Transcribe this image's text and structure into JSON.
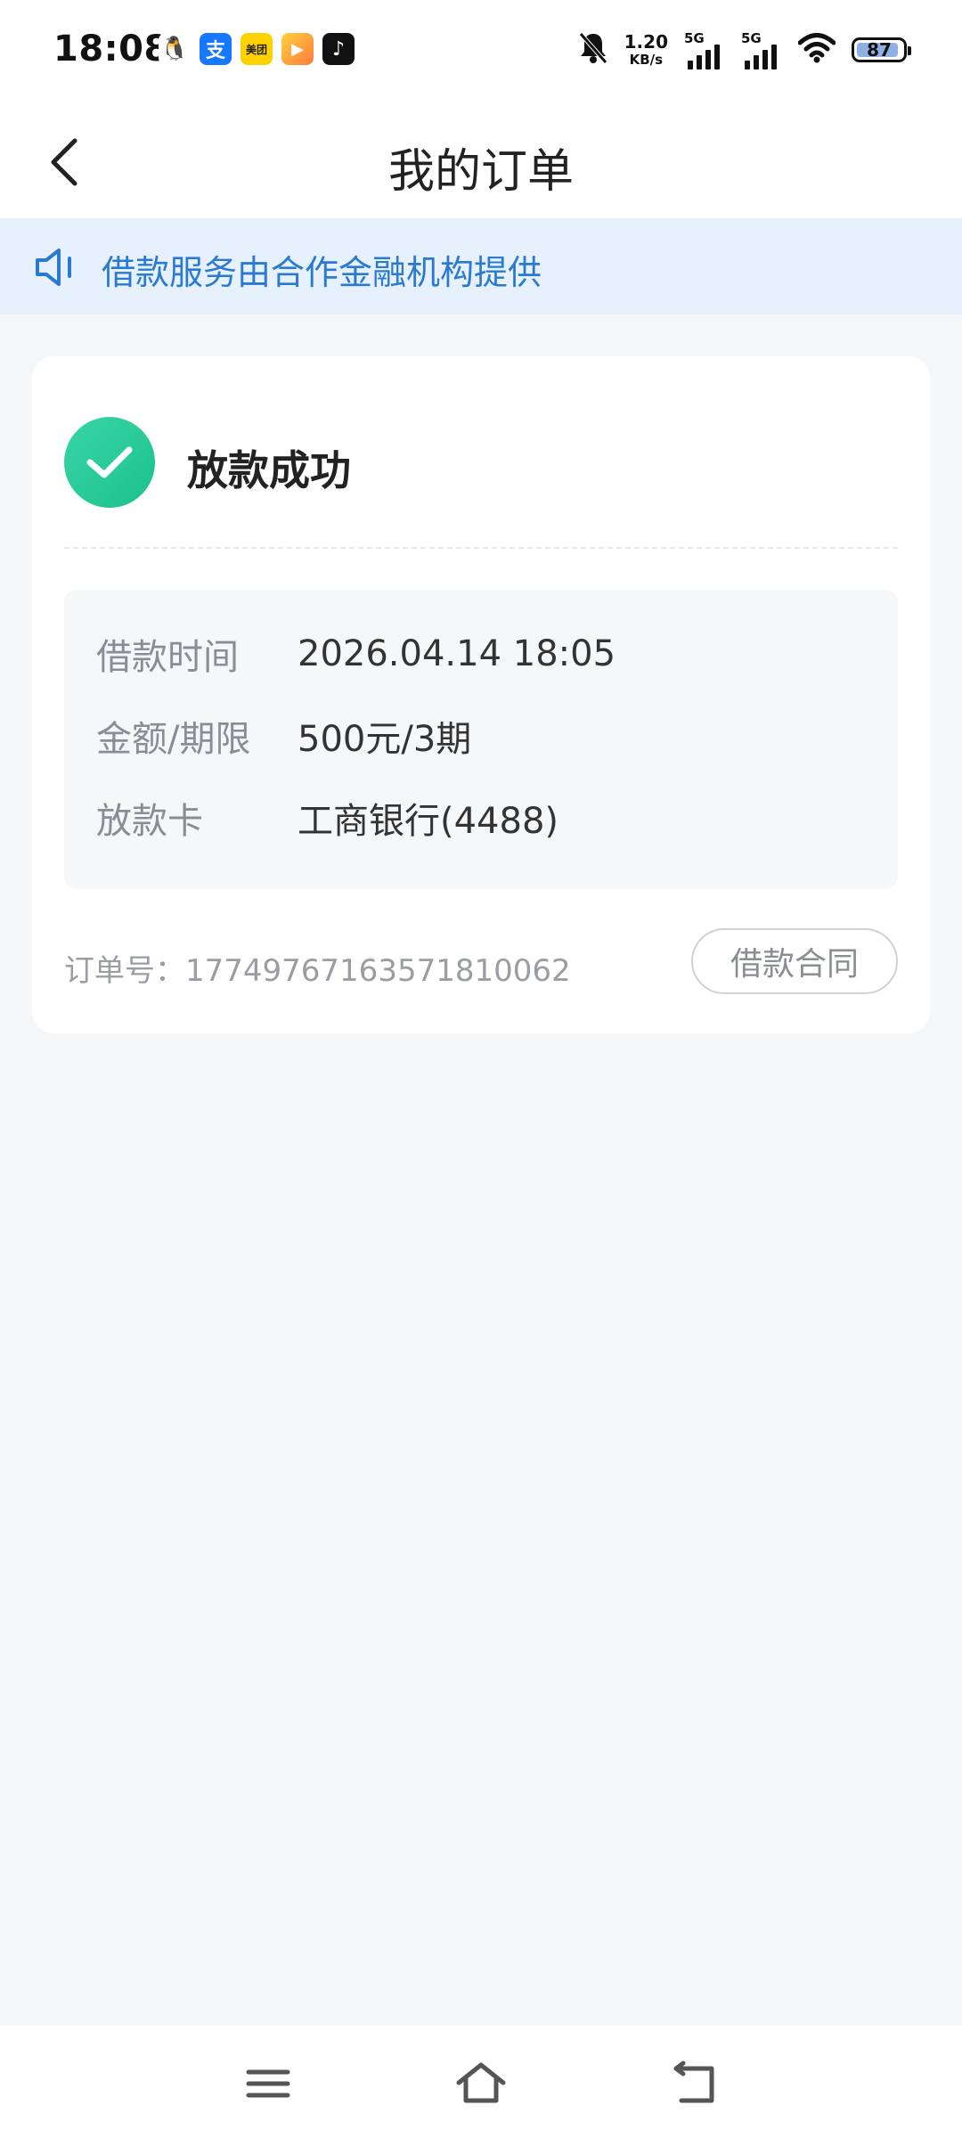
{
  "status_bar": {
    "time": "18:08",
    "apps": [
      {
        "icon": "qq-icon",
        "color": "#ffffff",
        "glyph": "🐧"
      },
      {
        "icon": "alipay-icon",
        "color": "#1677ff",
        "glyph": "支"
      },
      {
        "icon": "meituan-icon",
        "color": "#ffd100",
        "glyph": "美团"
      },
      {
        "icon": "video-app-icon",
        "color": "#ff9d2e",
        "glyph": "▶"
      },
      {
        "icon": "douyin-icon",
        "color": "#111111",
        "glyph": "♪"
      }
    ],
    "net_speed_value": "1.20",
    "net_speed_unit": "KB/s",
    "sim1_label": "5G",
    "sim2_label": "5G",
    "battery": "87"
  },
  "header": {
    "title": "我的订单"
  },
  "notice": {
    "text": "借款服务由合作金融机构提供"
  },
  "order": {
    "status": "放款成功",
    "details": [
      {
        "label": "借款时间",
        "value": "2026.04.14 18:05"
      },
      {
        "label": "金额/期限",
        "value": "500元/3期"
      },
      {
        "label": "放款卡",
        "value": "工商银行(4488)"
      }
    ],
    "order_number_label": "订单号：",
    "order_number": "1774976716357181006​2",
    "contract_button": "借款合同"
  },
  "colors": {
    "accent_blue": "#2b7ad1",
    "notice_bg": "#e6f1fd",
    "success_green": "#1cc08b",
    "page_bg": "#f5f6f8"
  }
}
